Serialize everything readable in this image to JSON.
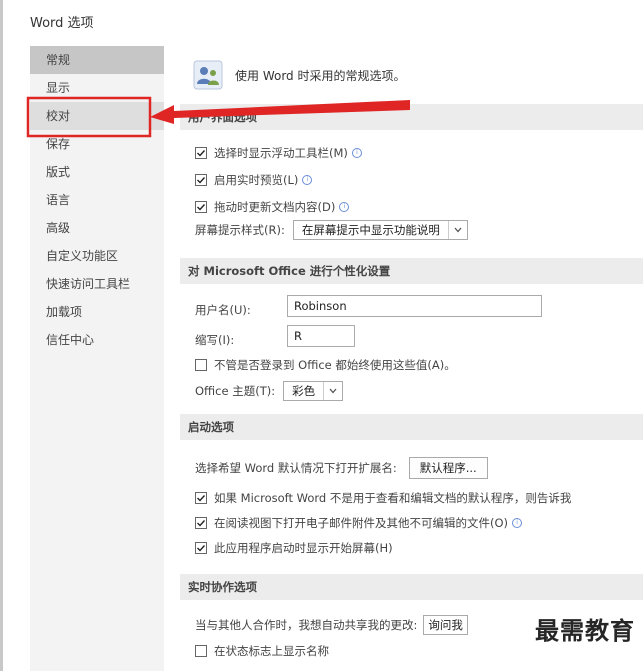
{
  "window": {
    "title": "Word 选项"
  },
  "sidebar": {
    "items": [
      {
        "label": "常规"
      },
      {
        "label": "显示"
      },
      {
        "label": "校对"
      },
      {
        "label": "保存"
      },
      {
        "label": "版式"
      },
      {
        "label": "语言"
      },
      {
        "label": "高级"
      },
      {
        "label": "自定义功能区"
      },
      {
        "label": "快速访问工具栏"
      },
      {
        "label": "加载项"
      },
      {
        "label": "信任中心"
      }
    ],
    "selected": "常规",
    "highlighted": "校对"
  },
  "main": {
    "intro": "使用 Word 时采用的常规选项。",
    "ui_section": {
      "header": "用户界面选项",
      "options": [
        {
          "label": "选择时显示浮动工具栏(M)",
          "checked": true
        },
        {
          "label": "启用实时预览(L)",
          "checked": true
        },
        {
          "label": "拖动时更新文档内容(D)",
          "checked": true
        }
      ],
      "screentip_label": "屏幕提示样式(R):",
      "screentip_value": "在屏幕提示中显示功能说明"
    },
    "personalize_section": {
      "header": "对 Microsoft Office 进行个性化设置",
      "username_label": "用户名(U):",
      "username_value": "Robinson",
      "initials_label": "缩写(I):",
      "initials_value": "R",
      "always_use_label": "不管是否登录到 Office 都始终使用这些值(A)。",
      "always_use_checked": false,
      "theme_label": "Office 主题(T):",
      "theme_value": "彩色"
    },
    "startup_section": {
      "header": "启动选项",
      "extensions_label": "选择希望 Word 默认情况下打开扩展名:",
      "default_programs_button": "默认程序...",
      "options": [
        {
          "label": "如果 Microsoft Word 不是用于查看和编辑文档的默认程序，则告诉我",
          "checked": true
        },
        {
          "label": "在阅读视图下打开电子邮件附件及其他不可编辑的文件(O)",
          "checked": true
        },
        {
          "label": "此应用程序启动时显示开始屏幕(H)",
          "checked": true
        }
      ]
    },
    "collab_section": {
      "header": "实时协作选项",
      "share_label": "当与其他人合作时，我想自动共享我的更改:",
      "share_value": "询问我",
      "presence_label": "在状态标志上显示名称",
      "presence_checked": false
    }
  },
  "watermark": "最需教育",
  "colors": {
    "callout": "#e02525",
    "selected": "#c6c6c6",
    "section_bg": "#ececec"
  },
  "icons": {
    "intro": "options-people-icon",
    "check": "check-icon",
    "chevron": "chevron-down-icon",
    "info": "info-icon"
  }
}
